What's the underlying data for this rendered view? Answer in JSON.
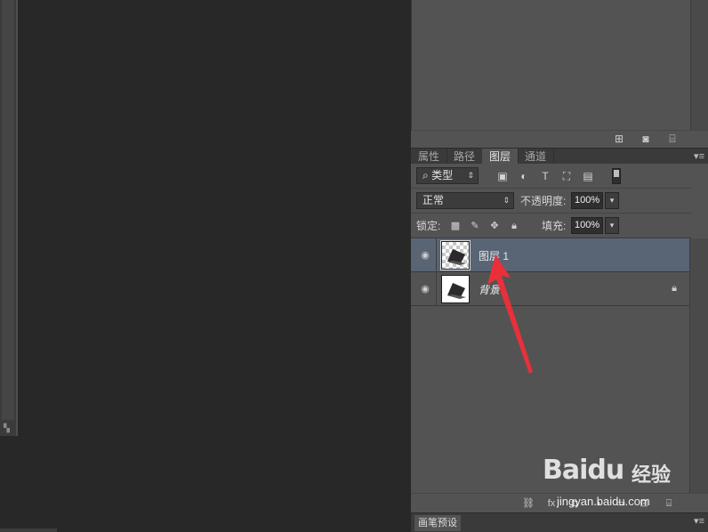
{
  "tabs": [
    {
      "label": "属性",
      "active": false
    },
    {
      "label": "路径",
      "active": false
    },
    {
      "label": "图层",
      "active": true
    },
    {
      "label": "通道",
      "active": false
    }
  ],
  "filter": {
    "kind_label": "类型"
  },
  "blend": {
    "mode": "正常",
    "opacity_label": "不透明度:",
    "opacity_value": "100%"
  },
  "lock_row": {
    "lock_label": "锁定:",
    "fill_label": "填充:",
    "fill_value": "100%"
  },
  "layers": [
    {
      "name": "图层 1",
      "selected": true,
      "locked": false
    },
    {
      "name": "背景",
      "selected": false,
      "locked": true
    }
  ],
  "brush_panel": {
    "tab_label": "画笔预设"
  },
  "watermark": {
    "logo": "Baidu",
    "brand": "经验",
    "domain": "jingyan.baidu.com"
  },
  "colors": {
    "selection": "#596475",
    "annotation_arrow": "#e8303a",
    "panel_bg": "#535353",
    "canvas_bg": "#282828"
  },
  "icons": {
    "top_toolbar": [
      "new-snapshot-icon",
      "camera-icon",
      "trash-icon"
    ],
    "filter": [
      "image-filter-icon",
      "adjustment-filter-icon",
      "type-filter-icon",
      "shape-filter-icon",
      "smart-object-filter-icon"
    ],
    "lock": [
      "lock-transparency-icon",
      "lock-paint-icon",
      "lock-position-icon",
      "lock-all-icon"
    ],
    "footer": [
      "link-layers-icon",
      "fx-icon",
      "mask-icon",
      "adjustment-layer-icon",
      "group-icon",
      "new-layer-icon",
      "delete-layer-icon"
    ]
  }
}
